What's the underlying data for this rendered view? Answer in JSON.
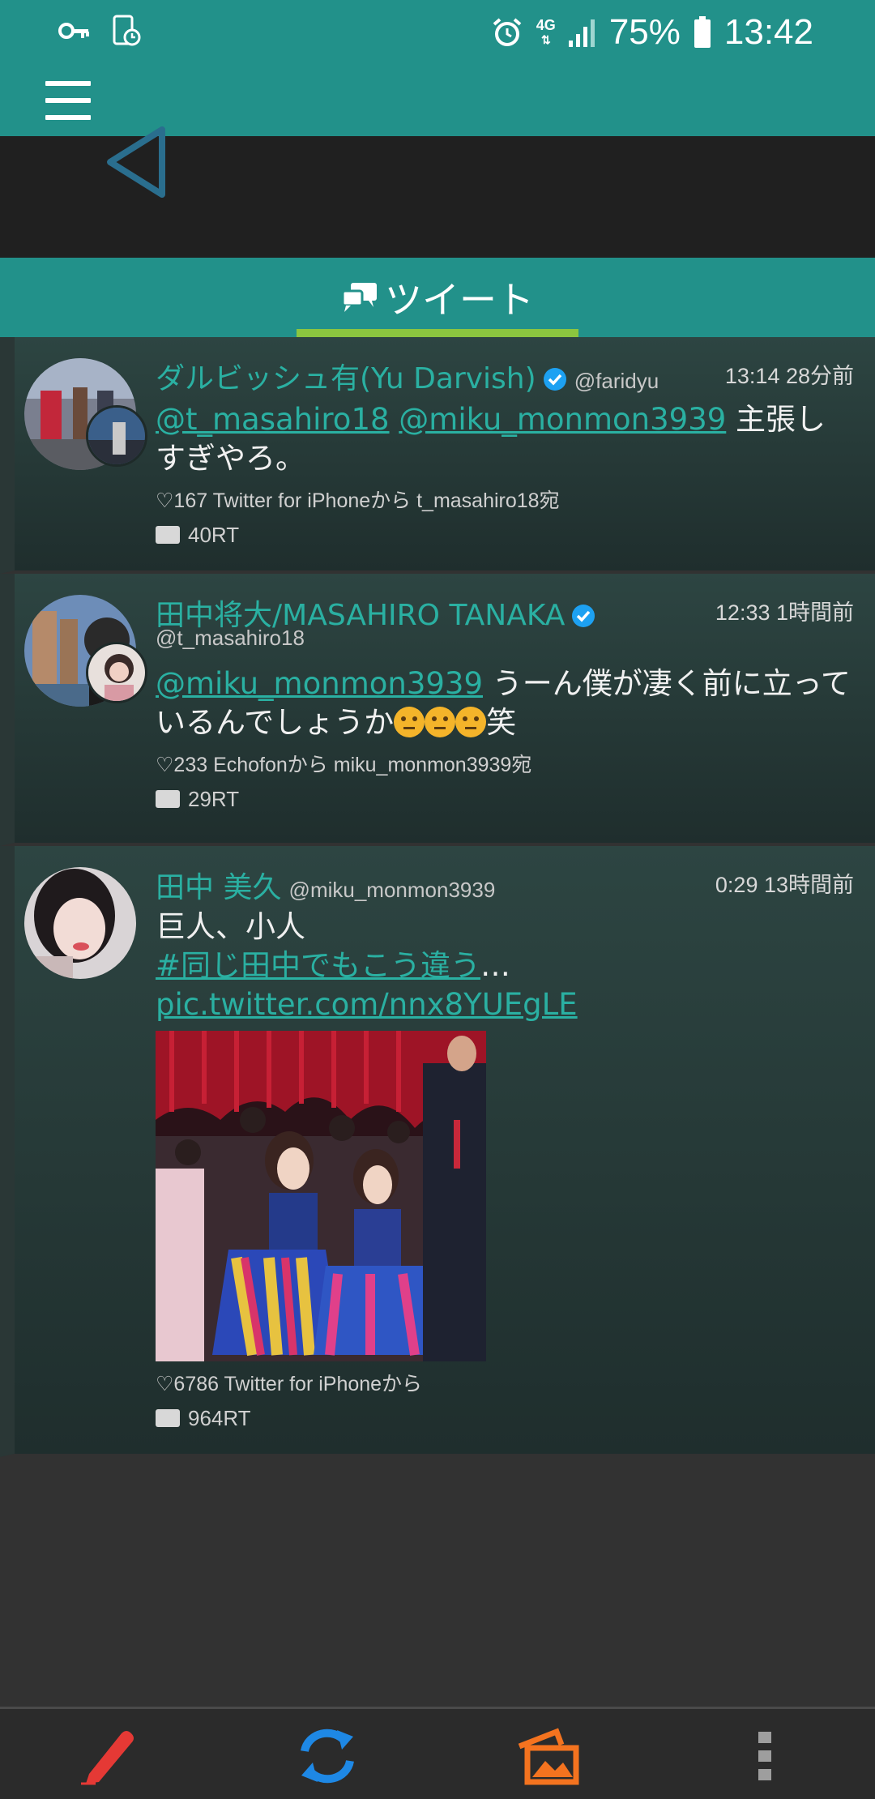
{
  "status_bar": {
    "network": "4G",
    "battery": "75%",
    "time": "13:42",
    "icons": [
      "key-icon",
      "phone-time-icon",
      "alarm-icon",
      "signal-icon",
      "battery-icon"
    ]
  },
  "tab": {
    "label": "ツイート",
    "icon": "chat-bubbles-icon"
  },
  "tweets": [
    {
      "name": "ダルビッシュ有(Yu Darvish)",
      "screen_name": "@faridyu",
      "verified": true,
      "time": "13:14 28分前",
      "text_links": [
        "@t_masahiro18",
        "@miku_monmon3939"
      ],
      "text": " 主張しすぎやろ。",
      "meta": "♡167 Twitter for iPhoneから t_masahiro18宛",
      "retweets": "40RT"
    },
    {
      "name": "田中将大/MASAHIRO TANAKA",
      "screen_name": "@t_masahiro18",
      "verified": true,
      "time": "12:33 1時間前",
      "text_links": [
        "@miku_monmon3939"
      ],
      "text": " うーん僕が凄く前に立っているんでしょうか",
      "text_suffix": "笑",
      "emoji_count": 3,
      "meta": "♡233 Echofonから miku_monmon3939宛",
      "retweets": "29RT"
    },
    {
      "name": "田中 美久",
      "screen_name": "@miku_monmon3939",
      "verified": false,
      "time": "0:29 13時間前",
      "text": "巨人、小人",
      "hashtag": "#同じ田中でもこう違う",
      "ellipsis": "… ",
      "pic_link": "pic.twitter.com/nnx8YUEgLE",
      "meta": "♡6786 Twitter for iPhoneから",
      "retweets": "964RT"
    }
  ],
  "bottom_bar": {
    "items": [
      "compose-icon",
      "refresh-icon",
      "gallery-icon",
      "more-vertical-icon"
    ],
    "colors": {
      "compose": "#e53935",
      "refresh": "#1e88e5",
      "gallery": "#f4731f",
      "more": "#9e9e9e"
    }
  },
  "colors": {
    "primary": "#22918a",
    "accent": "#8bc63f",
    "link": "#2ab0a2"
  }
}
